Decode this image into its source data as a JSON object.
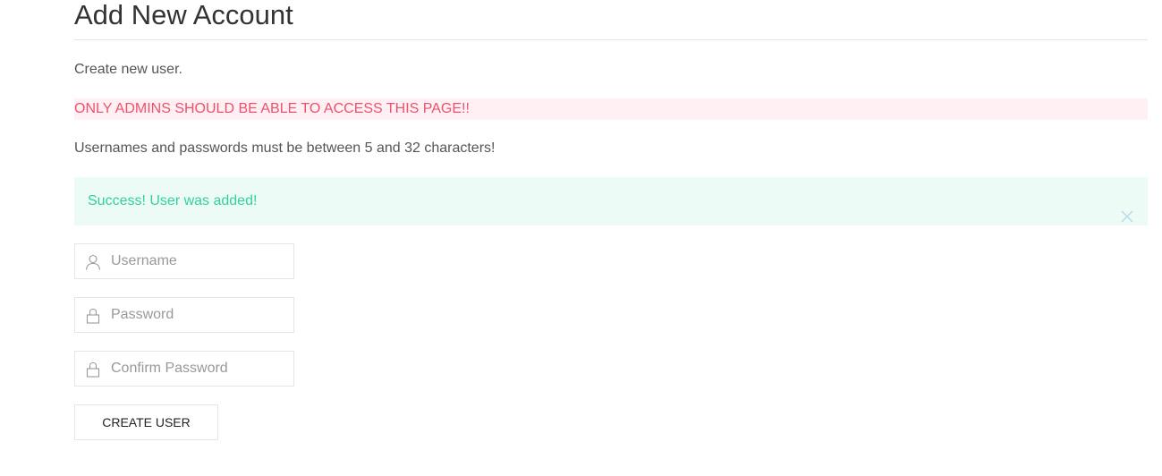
{
  "page": {
    "title": "Add New Account",
    "intro": "Create new user.",
    "warning": "ONLY ADMINS SHOULD BE ABLE TO ACCESS THIS PAGE!!",
    "rules": "Usernames and passwords must be between 5 and 32 characters!"
  },
  "alert": {
    "message": "Success! User was added!",
    "close_icon": "close-icon",
    "color": "#32d296",
    "background": "#edfbf6"
  },
  "form": {
    "username": {
      "placeholder": "Username",
      "value": "",
      "icon": "user-icon"
    },
    "password": {
      "placeholder": "Password",
      "value": "",
      "icon": "lock-icon"
    },
    "confirm_password": {
      "placeholder": "Confirm Password",
      "value": "",
      "icon": "lock-icon"
    },
    "submit_label": "CREATE USER"
  },
  "colors": {
    "warning_text": "#f0506e",
    "warning_background": "#fff1f3"
  }
}
